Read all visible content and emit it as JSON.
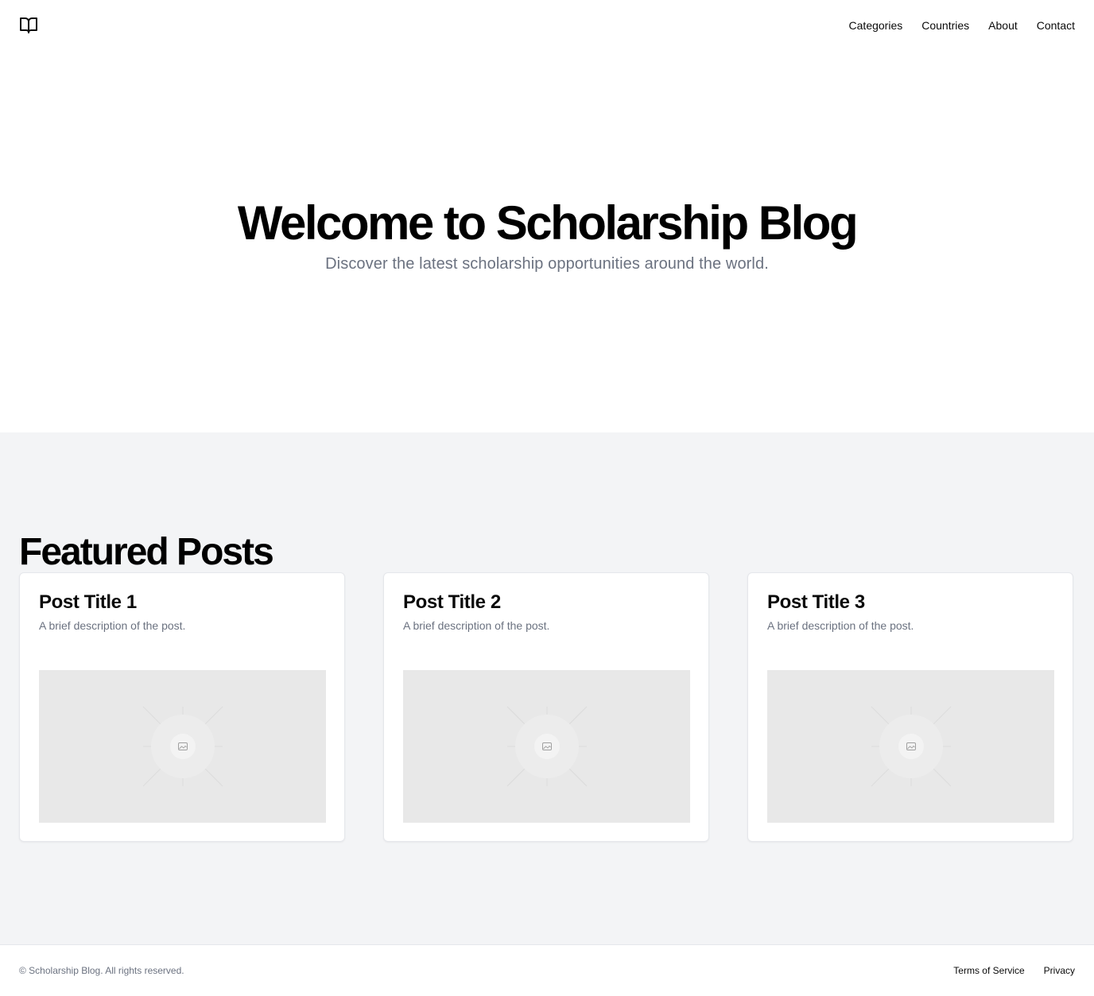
{
  "header": {
    "logo_icon": "book-open-icon",
    "nav": [
      {
        "label": "Categories"
      },
      {
        "label": "Countries"
      },
      {
        "label": "About"
      },
      {
        "label": "Contact"
      }
    ]
  },
  "hero": {
    "title": "Welcome to Scholarship Blog",
    "subtitle": "Discover the latest scholarship opportunities around the world."
  },
  "featured": {
    "heading": "Featured Posts",
    "posts": [
      {
        "title": "Post Title 1",
        "description": "A brief description of the post.",
        "image_icon": "image-placeholder-icon"
      },
      {
        "title": "Post Title 2",
        "description": "A brief description of the post.",
        "image_icon": "image-placeholder-icon"
      },
      {
        "title": "Post Title 3",
        "description": "A brief description of the post.",
        "image_icon": "image-placeholder-icon"
      }
    ]
  },
  "footer": {
    "copyright": "© Scholarship Blog. All rights reserved.",
    "links": [
      {
        "label": "Terms of Service"
      },
      {
        "label": "Privacy"
      }
    ]
  },
  "colors": {
    "text": "#0a0a0a",
    "muted": "#6b7280",
    "section_bg": "#f3f4f6",
    "border": "#e5e7eb",
    "placeholder_bg": "#e8e8e8"
  }
}
